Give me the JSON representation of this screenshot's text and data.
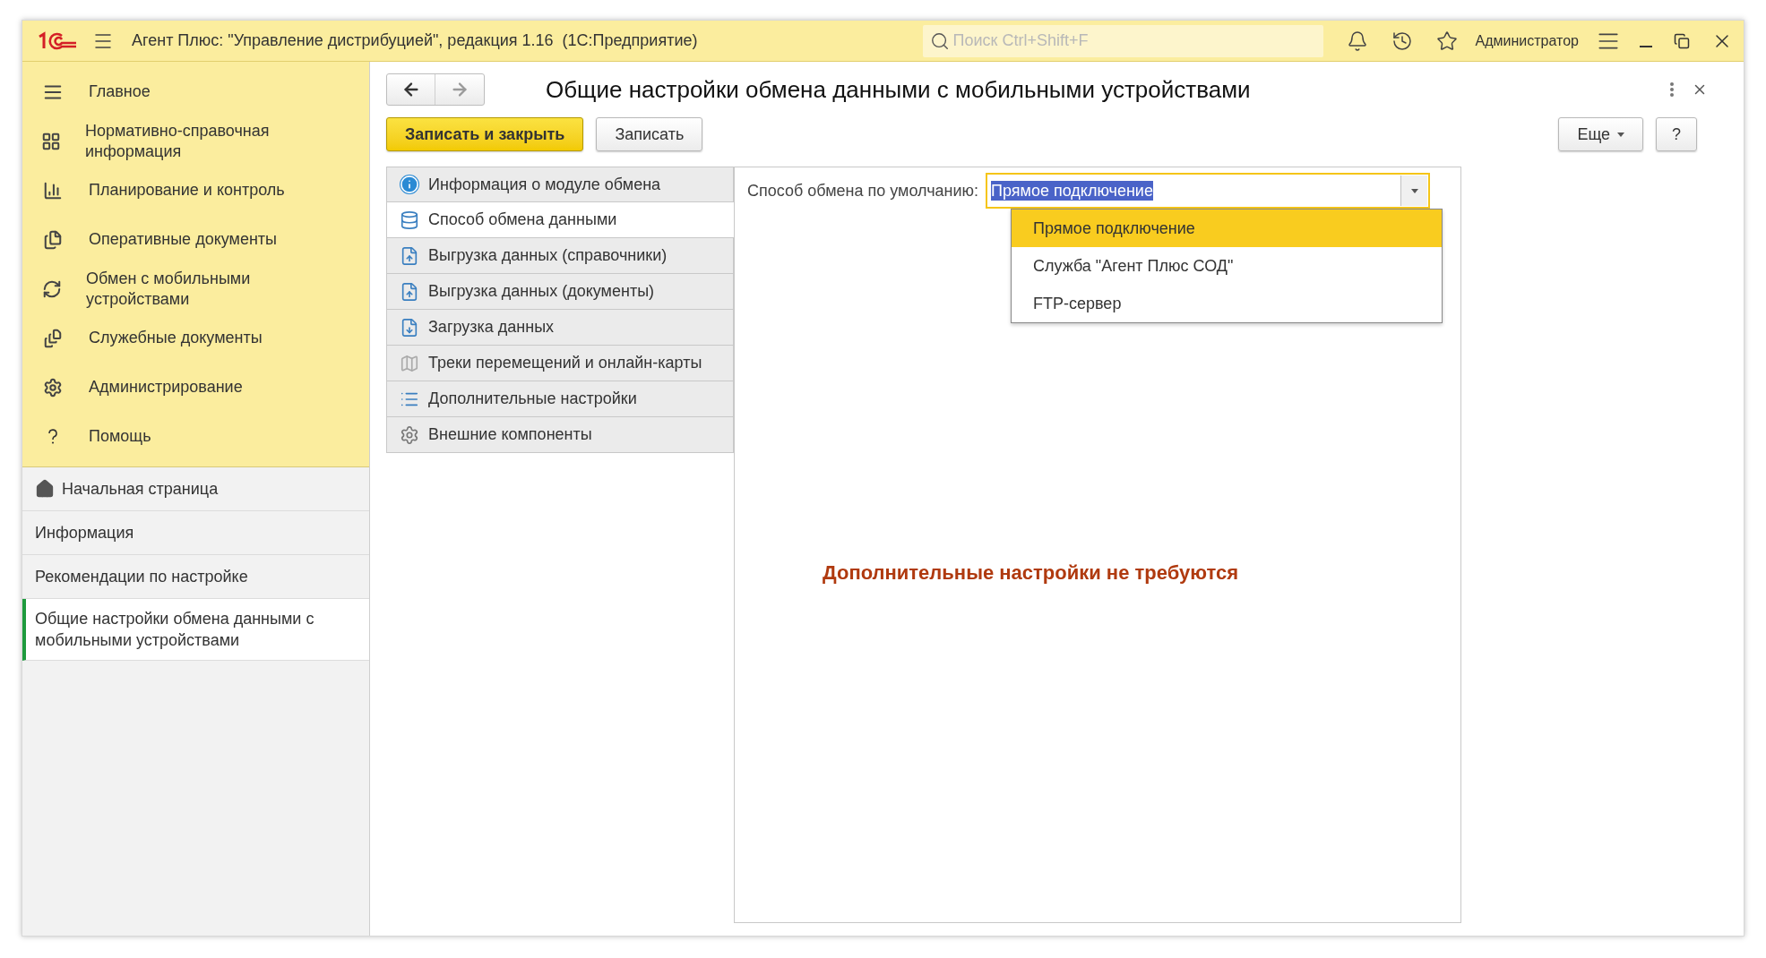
{
  "window": {
    "title": "Агент Плюс: \"Управление дистрибуцией\", редакция 1.16  (1С:Предприятие)",
    "search": {
      "placeholder": "Поиск Ctrl+Shift+F"
    },
    "user": "Администратор"
  },
  "sidebar": {
    "sections": [
      {
        "label": "Главное"
      },
      {
        "label": "Нормативно-справочная информация"
      },
      {
        "label": "Планирование и контроль"
      },
      {
        "label": "Оперативные документы"
      },
      {
        "label": "Обмен с мобильными устройствами"
      },
      {
        "label": "Служебные документы"
      },
      {
        "label": "Администрирование"
      },
      {
        "label": "Помощь"
      }
    ],
    "open_windows": [
      {
        "label": "Начальная страница",
        "kind": "home",
        "selected": false
      },
      {
        "label": "Информация",
        "kind": "page",
        "selected": false
      },
      {
        "label": "Рекомендации по настройке",
        "kind": "page",
        "selected": false
      },
      {
        "label": "Общие настройки обмена данными с мобильными устройствами",
        "kind": "page",
        "selected": true
      }
    ]
  },
  "form": {
    "title": "Общие настройки обмена данными с мобильными устройствами",
    "nav": {
      "back_disabled": false,
      "forward_disabled": true
    },
    "buttons": [
      {
        "label": "Записать и закрыть",
        "kind": "primary"
      },
      {
        "label": "Записать",
        "kind": "default"
      }
    ],
    "more_button": "Еще",
    "help_button": "?",
    "sections": [
      {
        "label": "Информация о модуле обмена",
        "selected": false
      },
      {
        "label": "Способ обмена данными",
        "selected": true
      },
      {
        "label": "Выгрузка данных (справочники)",
        "selected": false
      },
      {
        "label": "Выгрузка данных (документы)",
        "selected": false
      },
      {
        "label": "Загрузка данных",
        "selected": false
      },
      {
        "label": "Треки перемещений и онлайн-карты",
        "selected": false
      },
      {
        "label": "Дополнительные настройки",
        "selected": false
      },
      {
        "label": "Внешние компоненты",
        "selected": false
      }
    ],
    "field": {
      "label": "Способ обмена по умолчанию:",
      "value": "Прямое подключение",
      "expanded": true,
      "options": [
        {
          "label": "Прямое подключение",
          "selected": true
        },
        {
          "label": "Служба \"Агент Плюс СОД\"",
          "selected": false
        },
        {
          "label": "FTP-сервер",
          "selected": false
        }
      ]
    },
    "message": "Дополнительные настройки не требуются"
  }
}
